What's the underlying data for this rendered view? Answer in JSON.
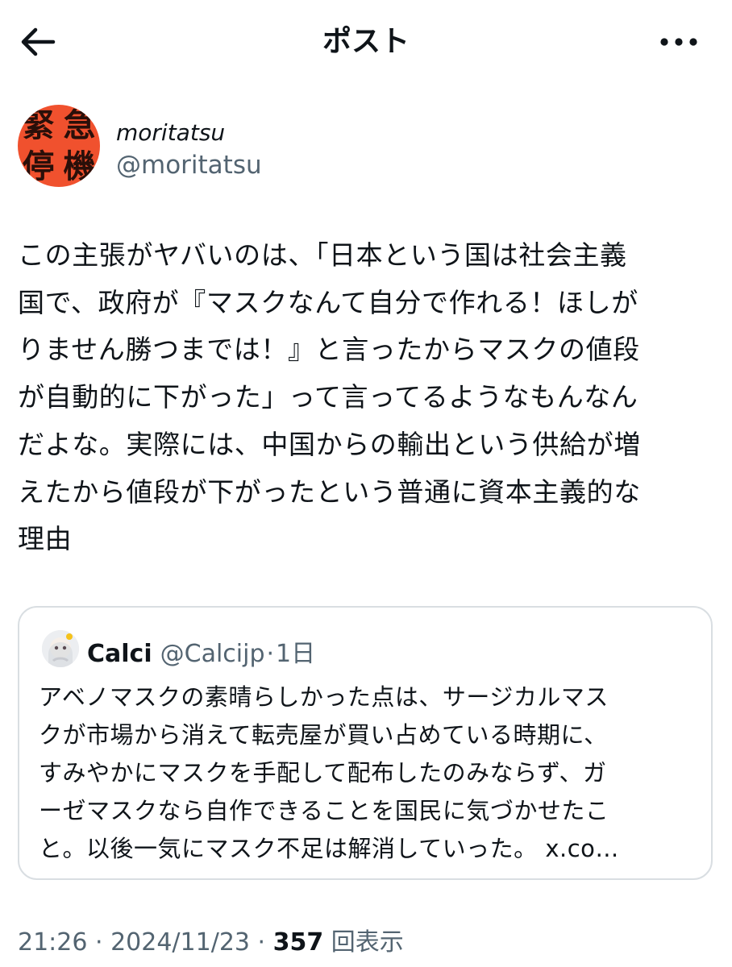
{
  "header": {
    "title": "ポスト"
  },
  "author": {
    "avatar_text": [
      "緊",
      "急",
      "停",
      "機"
    ],
    "display_name": "moritatsu",
    "handle": "@moritatsu"
  },
  "post": {
    "text": "この主張がヤバいのは、「日本という国は社会主義\n国で、政府が『マスクなんて自分で作れる！ほしが\nりません勝つまでは！』と言ったからマスクの値段\nが自動的に下がった」って言ってるようなもんなん\nだよな。実際には、中国からの輸出という供給が増\nえたから値段が下がったという普通に資本主義的な\n理由"
  },
  "quote": {
    "name": "Calci",
    "handle": "@Calcijp",
    "separator": "·",
    "time": "1日",
    "text": "アベノマスクの素晴らしかった点は、サージカルマス\nクが市場から消えて転売屋が買い占めている時期に、\nすみやかにマスクを手配して配布したのみならず、ガ\nーゼマスクなら自作できることを国民に気づかせたこ\nと。以後一気にマスク不足は解消していった。 x.co…"
  },
  "footer": {
    "time": "21:26",
    "sep1": " · ",
    "date": "2024/11/23",
    "sep2": " · ",
    "views": "357",
    "views_label": " 回表示"
  },
  "colors": {
    "text": "#0f1419",
    "secondary": "#536471",
    "border": "#d9dee2",
    "avatar_bg": "#f0512e"
  },
  "icons": {
    "back": "arrow-left-icon",
    "more": "more-horizontal-icon"
  }
}
